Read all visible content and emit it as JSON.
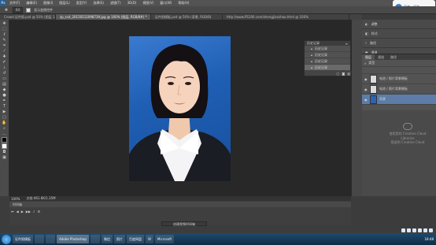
{
  "app": {
    "logo": "Ps"
  },
  "menubar": {
    "items": [
      "文件(F)",
      "编辑(E)",
      "图像(I)",
      "图层(L)",
      "类型(Y)",
      "选择(S)",
      "滤镜(T)",
      "3D(D)",
      "视图(V)",
      "窗口(W)",
      "帮助(H)"
    ]
  },
  "options": {
    "size_value": "64",
    "checkbox_label": "显示变换控件"
  },
  "doc_tabs": [
    {
      "label": "Crowd 证件照.psd @ 50% (图层 1, RGB/8)",
      "active": false
    },
    {
      "label": "zp_scd_20150512098739.jpg @ 100% (图层, RGB/8#) *",
      "active": true
    },
    {
      "label": "证件照模板.psd @ 50% (背景, RGB/8)",
      "active": false
    },
    {
      "label": "http://www.PS100.com/zhengjianzhao.html @ 100%",
      "active": false
    }
  ],
  "history": {
    "title": "历史记录",
    "items": [
      "历史记录",
      "历史记录",
      "历史记录",
      "历史记录"
    ],
    "selected_index": 3
  },
  "right_panel": {
    "rows": [
      "调整",
      "样式",
      "路径",
      "通道"
    ]
  },
  "layers": {
    "tabs": [
      "图层",
      "通道",
      "路径"
    ],
    "kind_label": "类型",
    "rows": [
      {
        "name": "电池 / 照片背景模板",
        "selected": false
      },
      {
        "name": "电池 / 照片背景模板",
        "selected": false
      },
      {
        "name": "背景",
        "selected": true
      }
    ]
  },
  "cc_library": {
    "line1": "使用您的 Creative Cloud Libraries",
    "line2": "登录到 Creative Cloud"
  },
  "status": {
    "zoom": "100%",
    "doc_size": "文档:461.6K/1.35M"
  },
  "timeline": {
    "title": "时间轴",
    "create_button": "创建视频时间轴"
  },
  "taskbar": {
    "items": [
      {
        "label": "",
        "active": false
      },
      {
        "label": "证件照模板",
        "active": false
      },
      {
        "label": "",
        "active": false
      },
      {
        "label": "",
        "active": false
      },
      {
        "label": "Adobe Photoshop",
        "active": true
      },
      {
        "label": "",
        "active": false
      },
      {
        "label": "微信",
        "active": false
      },
      {
        "label": "照片",
        "active": false
      },
      {
        "label": "百度网盘",
        "active": false
      },
      {
        "label": "W",
        "active": false
      },
      {
        "label": "Microsoft",
        "active": false
      }
    ],
    "clock": "18:48"
  },
  "overlay": {
    "brand": "百度 · 经验"
  }
}
